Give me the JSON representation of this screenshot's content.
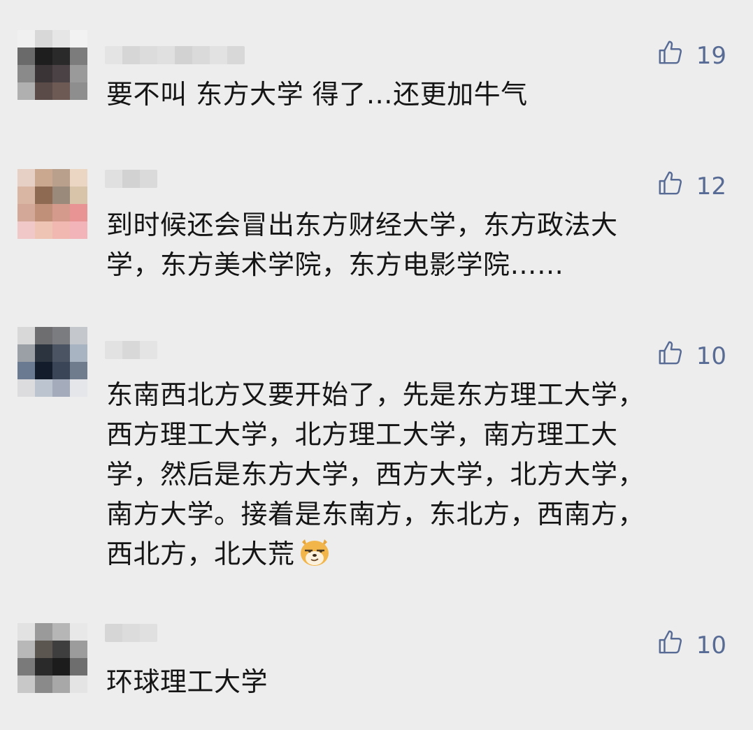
{
  "comments": [
    {
      "likes": "19",
      "lines": [
        "要不叫 东方大学 得了…还更加牛气"
      ],
      "avatar_tiles": [
        "#f0f0f0",
        "#d8d8d8",
        "#e6e6e6",
        "#f2f2f2",
        "#6a6a6a",
        "#1e1e1e",
        "#2a2a2a",
        "#7c7c7c",
        "#8a8a8a",
        "#3a3436",
        "#4a4244",
        "#9a9a9a",
        "#b0b0b0",
        "#5a4a48",
        "#6e5a54",
        "#8e8e8e"
      ]
    },
    {
      "likes": "12",
      "lines": [
        "到时候还会冒出东方财经大学，东方政法大",
        "学，东方美术学院，东方电影学院……"
      ],
      "avatar_tiles": [
        "#e6cfc4",
        "#caa88f",
        "#b8a08c",
        "#ead6c2",
        "#d9b6a4",
        "#8f6a52",
        "#9a8a7c",
        "#d8c4a8",
        "#d4a898",
        "#c09078",
        "#d49a8c",
        "#e89494",
        "#f0c8c8",
        "#eec4b4",
        "#f0b8b0",
        "#f2b4b8"
      ]
    },
    {
      "likes": "10",
      "lines": [
        "东南西北方又要开始了，先是东方理工大学，",
        "西方理工大学，北方理工大学，南方理工大",
        "学，然后是东方大学，西方大学，北方大学，",
        "南方大学。接着是东南方，东北方，西南方，",
        "西北方，北大荒"
      ],
      "emoji": "smirk-dog-emoji",
      "avatar_tiles": [
        "#d8d8d8",
        "#6e6e70",
        "#7a7c80",
        "#c4c8cc",
        "#9aa0a6",
        "#2c3440",
        "#4a5462",
        "#a8b4c2",
        "#6a7a90",
        "#121c2a",
        "#3a4658",
        "#6e7c8e",
        "#dcdcde",
        "#bcc4d0",
        "#a4acbc",
        "#e4e6ea"
      ]
    },
    {
      "likes": "10",
      "lines": [
        "环球理工大学"
      ],
      "avatar_tiles": [
        "#e2e2e2",
        "#9a9a9a",
        "#b6b6b6",
        "#e8e8e8",
        "#b8b8b8",
        "#5c5650",
        "#3e3e3e",
        "#9c9c9c",
        "#7a7a7a",
        "#2a2a2a",
        "#1c1c1c",
        "#6e6e6e",
        "#c8c8c8",
        "#8a8a8a",
        "#a8a8a8",
        "#e4e4e4"
      ]
    }
  ]
}
